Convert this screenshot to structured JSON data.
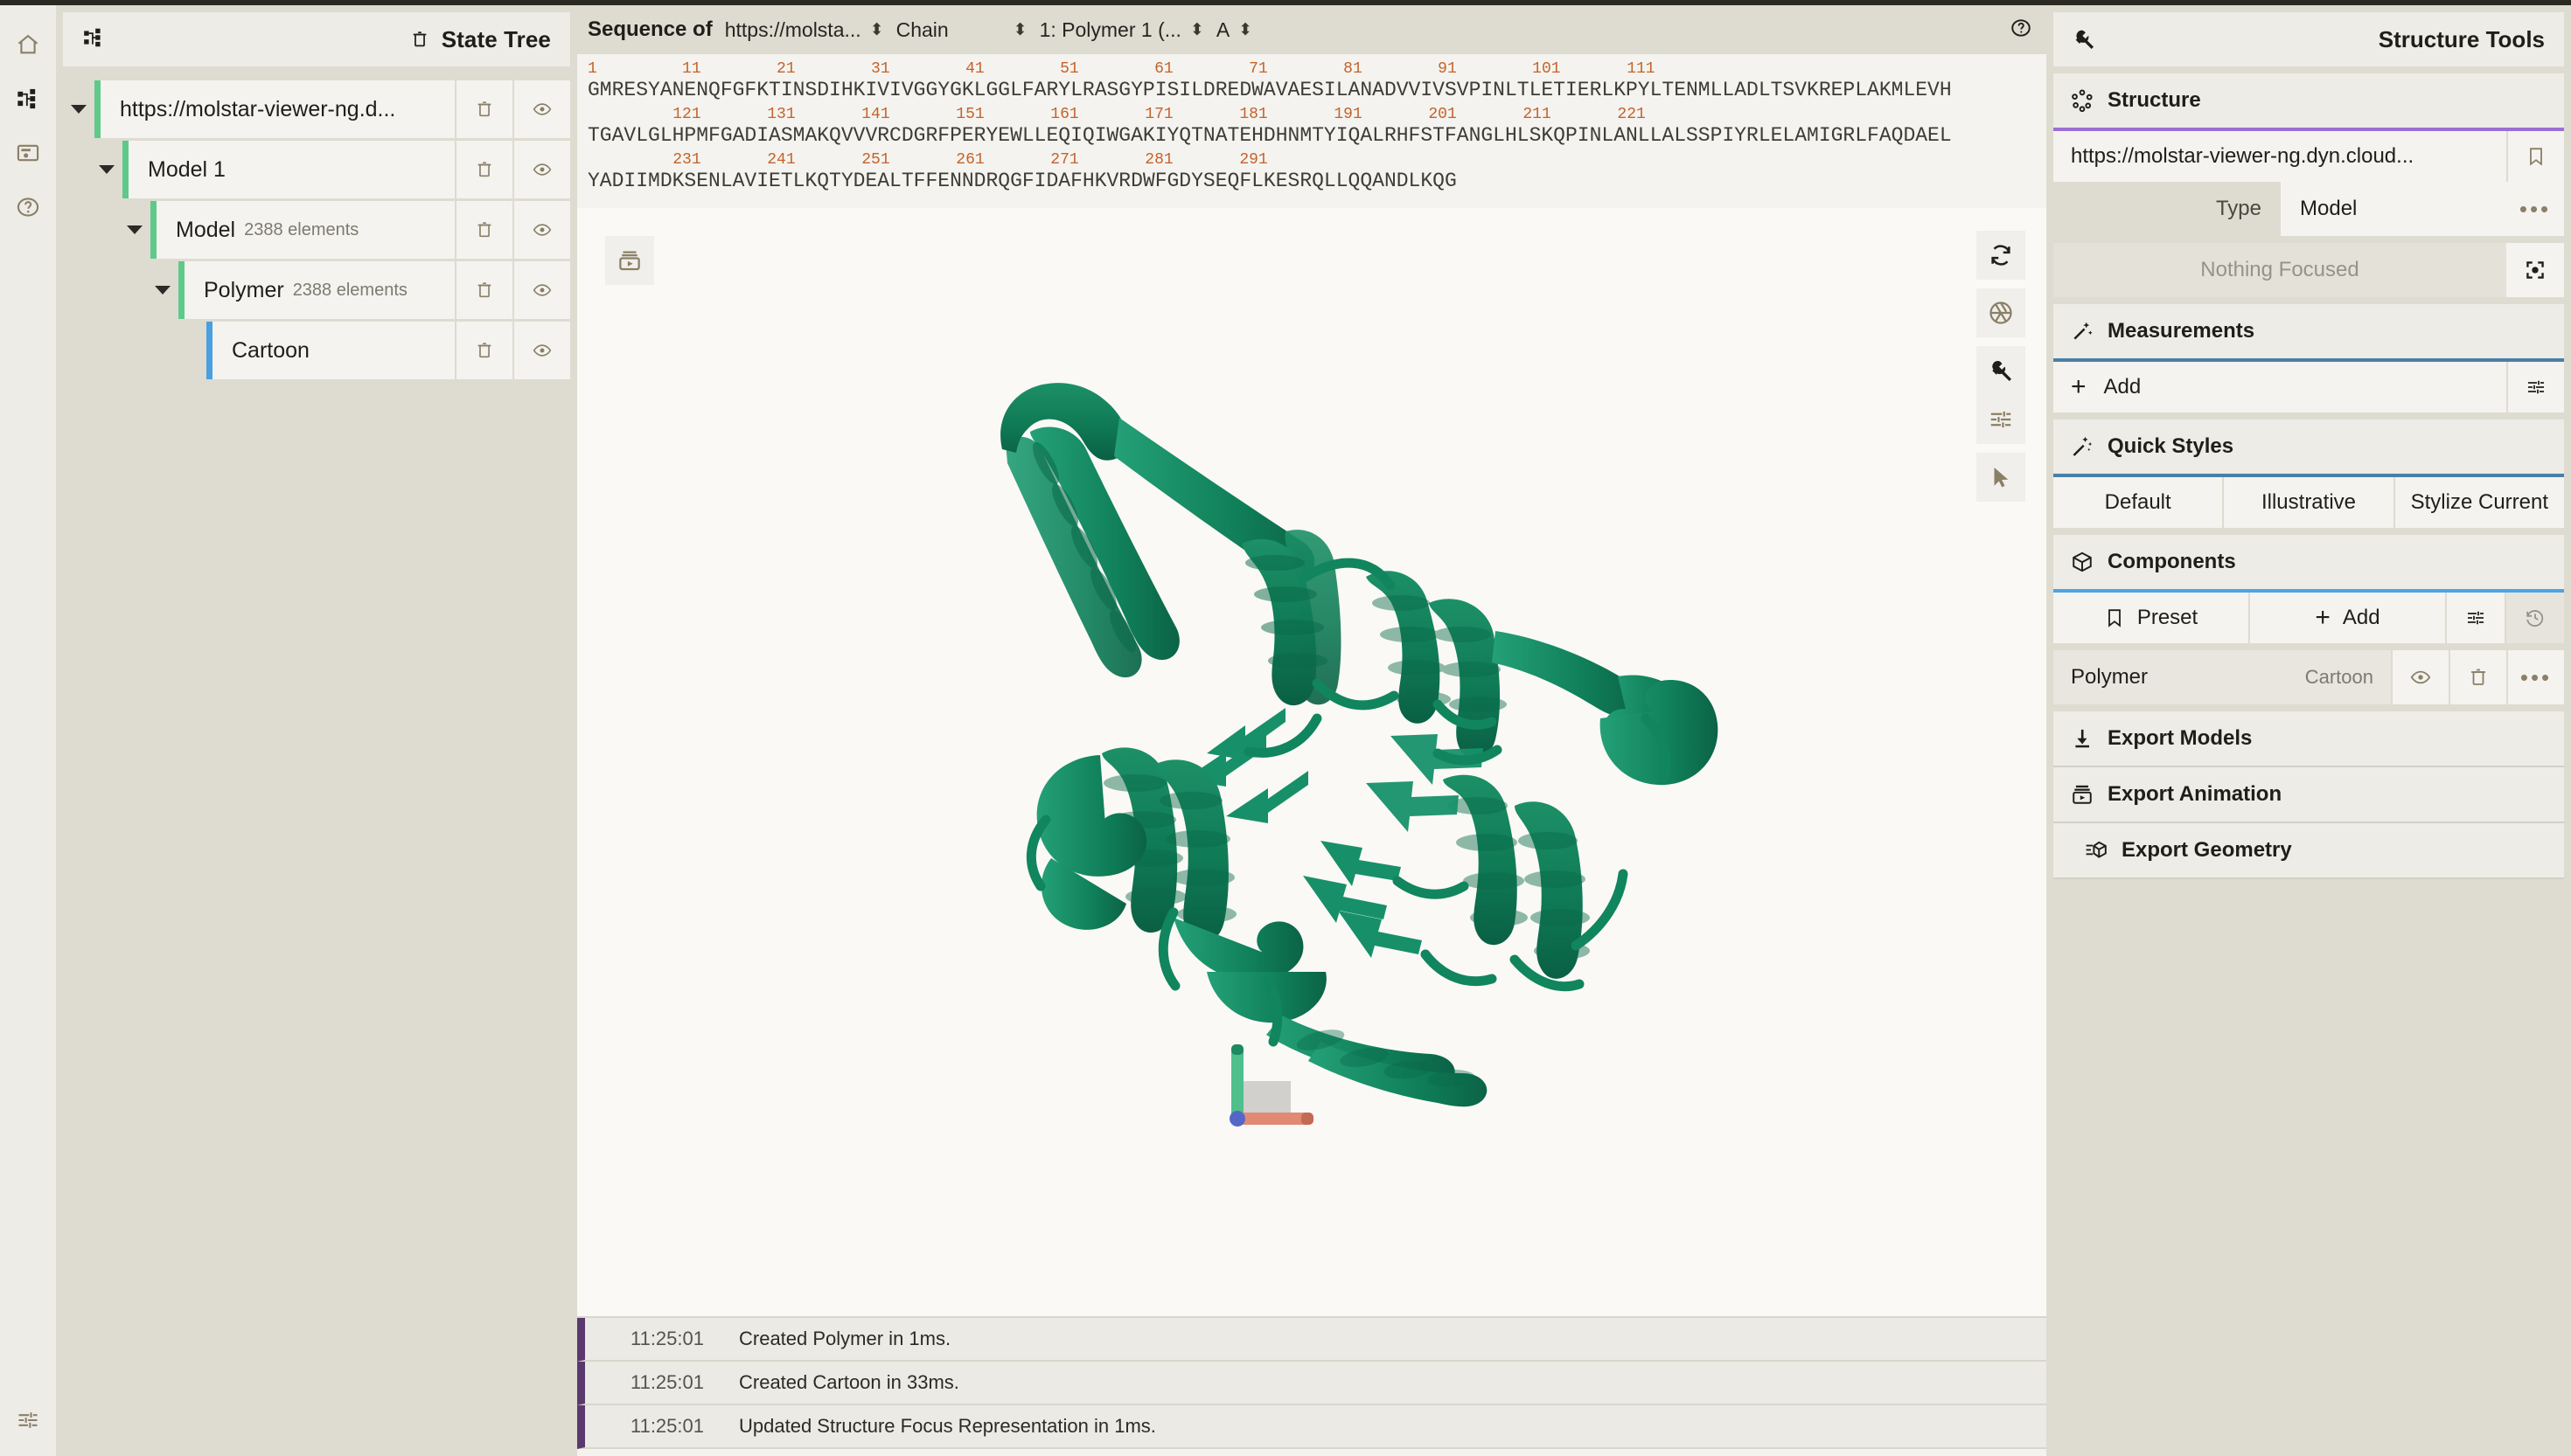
{
  "rail": {
    "items": [
      {
        "name": "home-icon",
        "label": "Home"
      },
      {
        "name": "state-tree-icon",
        "label": "State Tree"
      },
      {
        "name": "save-session-icon",
        "label": "Session"
      },
      {
        "name": "help-icon",
        "label": "Help"
      }
    ],
    "bottom": {
      "name": "settings-sliders-icon",
      "label": "Settings"
    }
  },
  "state_tree": {
    "title": "State Tree",
    "rows": [
      {
        "label": "https://molstar-viewer-ng.d...",
        "sub": "",
        "indent": 1,
        "type": "branch"
      },
      {
        "label": "Model 1",
        "sub": "",
        "indent": 2,
        "type": "branch"
      },
      {
        "label": "Model",
        "sub": "2388 elements",
        "indent": 3,
        "type": "branch"
      },
      {
        "label": "Polymer",
        "sub": "2388 elements",
        "indent": 4,
        "type": "branch"
      },
      {
        "label": "Cartoon",
        "sub": "",
        "indent": 4,
        "type": "leaf"
      }
    ],
    "row_actions": [
      "delete-icon",
      "visibility-icon"
    ]
  },
  "sequence": {
    "label": "Sequence of",
    "selectors": [
      {
        "name": "structure-select",
        "value": "https://molsta..."
      },
      {
        "name": "entity-select",
        "value": "Chain"
      },
      {
        "name": "chain-select",
        "value": "1: Polymer 1 (..."
      },
      {
        "name": "operator-select",
        "value": "A"
      }
    ],
    "lines": [
      {
        "ticks": "1         11        21        31        41        51        61        71        81        91        101       111",
        "residues": "GMRESYANENQFGFKTINSDIHKIVIVGGYGKLGGLFARYLRASGYPISILDREDWAVAESILANADVVIVSVPINLTLETIERLKPYLTENMLLADLTSVKREPLAKMLEVH"
      },
      {
        "ticks": "         121       131       141       151       161       171       181       191       201       211       221",
        "residues": "TGAVLGLHPMFGADIASMAKQVVVRCDGRFPERYEWLLEQIQIWGAKIYQTNATEHDHNMTYIQALRHFSTFANGLHLSKQPINLANLLALSSPIYRLELAMIGRLFAQDAEL"
      },
      {
        "ticks": "         231       241       251       261       271       281       291",
        "residues": "YADIIMDKSENLAVIETLKQTYDEALTFFENNDRQGFIDAFHKVRDWFGDYSEQFLKESRQLLQQANDLKQG"
      }
    ]
  },
  "viewport": {
    "top_left_button": "animation-icon",
    "tools": [
      {
        "name": "reset-camera-icon"
      },
      {
        "name": "screenshot-icon"
      },
      {
        "name": "viewport-settings-icon"
      },
      {
        "name": "controls-sliders-icon"
      },
      {
        "name": "selection-cursor-icon"
      }
    ],
    "structure_color": "#147a57",
    "axes": {
      "x_color": "#e08a74",
      "y_color": "#4fbf8b",
      "z_color": "#5566c9"
    }
  },
  "log": {
    "entries": [
      {
        "time": "11:25:01",
        "message": "Created Polymer in 1ms."
      },
      {
        "time": "11:25:01",
        "message": "Created Cartoon in 33ms."
      },
      {
        "time": "11:25:01",
        "message": "Updated Structure Focus Representation in 1ms."
      }
    ]
  },
  "structure_tools": {
    "title": "Structure Tools",
    "header_icon": "wrench-icon",
    "structure": {
      "section_title": "Structure",
      "section_icon": "molecule-icon",
      "source_url": "https://molstar-viewer-ng.dyn.cloud...",
      "bookmark_icon": "bookmark-icon",
      "type_key": "Type",
      "type_value": "Model",
      "more_label": "...",
      "focus_text": "Nothing Focused",
      "focus_icon": "focus-target-icon"
    },
    "measurements": {
      "section_title": "Measurements",
      "section_icon": "magic-wand-icon",
      "add_label": "Add",
      "options_icon": "sliders-icon"
    },
    "quick_styles": {
      "section_title": "Quick Styles",
      "section_icon": "magic-wand-sparkle-icon",
      "buttons": [
        "Default",
        "Illustrative",
        "Stylize Current"
      ]
    },
    "components": {
      "section_title": "Components",
      "section_icon": "cube-icon",
      "toolbar": [
        {
          "name": "preset-button",
          "label": "Preset",
          "icon": "bookmark-icon"
        },
        {
          "name": "add-component-button",
          "label": "Add",
          "icon": "plus-icon"
        },
        {
          "name": "component-options-button",
          "label": "",
          "icon": "sliders-icon"
        },
        {
          "name": "component-history-button",
          "label": "",
          "icon": "history-icon"
        }
      ],
      "items": [
        {
          "name": "Polymer",
          "representation": "Cartoon",
          "actions": [
            "visibility-icon",
            "delete-icon",
            "more-icon"
          ]
        }
      ]
    },
    "exports": [
      {
        "label": "Export Models",
        "icon": "download-icon"
      },
      {
        "label": "Export Animation",
        "icon": "animation-export-icon"
      },
      {
        "label": "Export Geometry",
        "icon": "geometry-export-icon"
      }
    ]
  }
}
